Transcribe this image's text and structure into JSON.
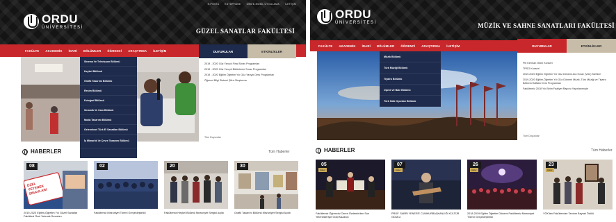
{
  "panel1": {
    "top_links": [
      "E-POSTA",
      "KÜTÜPHANE",
      "OBS/E-MOBİL UYGULAMA",
      "İLETİŞİM"
    ],
    "logo": {
      "name": "ORDU",
      "sub": "ÜNİVERSİTESİ"
    },
    "faculty": "GÜZEL SANATLAR FAKÜLTESİ",
    "nav": [
      "FAKÜLTE",
      "AKADEMİK",
      "İDARİ",
      "BÖLÜMLER",
      "ÖĞRENCİ",
      "ARAŞTIRMA",
      "İLETİŞİM"
    ],
    "tabs": {
      "announcements": "DUYURULAR",
      "events": "ETKİNLİKLER"
    },
    "dropdown": [
      "Sinema Ve Televizyon Bölümü",
      "Heykel Bölümü",
      "Grafik Tasarımı Bölümü",
      "Resim Bölümü",
      "Fotoğraf Bölümü",
      "Seramik Ve Cam Bölümü",
      "Moda Tasarımı Bölümü",
      "Geleneksel Türk El Sanatları Bölümü",
      "İç Mimarlık Ve Çevre Tasarımı Bölümü"
    ],
    "announcements": [
      "2019 - 2020 Güz Yarıyılı Final Sınav Programları",
      "2019 - 2020 Güz Yarıyılı Bütünleme Sınav Programları",
      "2019 - 2020 Eğitim Öğretim Yılı Güz Yarıyılı Ders Programları",
      "Öğrenci Bilgi Sistemi Şifre Oluşturma"
    ],
    "all_announcements": "Tüm Duyurular",
    "news_title": "HABERLER",
    "all_news": "Tüm Haberler",
    "news": [
      {
        "date": "08",
        "caption": "2019-2020 Eğitim-Öğretim Yılı Güzel Sanatlar Fakültesi Özel Yetenek Sınavları"
      },
      {
        "date": "02",
        "caption": "Fakültemiz Mezuniyet Töreni Gerçekleştirildi"
      },
      {
        "date": "20",
        "caption": "Fakültemiz Heykel Bölümü Mezuniyet Sergisi Açıldı"
      },
      {
        "date": "30",
        "caption": "Grafik Tasarımı Bölümü Mezuniyet Sergisi Açıldı"
      }
    ],
    "poster_text": [
      "ÖZEL",
      "YETENEK",
      "SINAVLARI"
    ]
  },
  "panel2": {
    "logo": {
      "name": "ORDU",
      "sub": "ÜNİVERSİTESİ"
    },
    "faculty": "MÜZİK VE SAHNE SANATLARI FAKÜLTESİ",
    "nav": [
      "FAKÜLTE",
      "AKADEMİK",
      "İDARİ",
      "BÖLÜMLER",
      "ÖĞRENCİ",
      "ARAŞTIRMA",
      "İLETİŞİM"
    ],
    "tabs": {
      "announcements": "DUYURULAR",
      "events": "ETKİNLİKLER"
    },
    "dropdown": [
      "Müzik Bölümü",
      "Türk Müziği Bölümü",
      "Tiyatro Bölümü",
      "Opera Ve Bale Bölümü",
      "Türk Halk Oyunları Bölümü"
    ],
    "announcements": [
      "Piri Kerman Ölüm Konseri",
      "TRSO Konseri",
      "2019-2020 Eğitim Öğretim Yılı Güz Dönemi Ara Sınav (Vize) Tarihleri",
      "2019-2020 Eğitim-Öğretim Yılı Güz Dönemi Müzik, Türk Müziği ve Tiyatro Bölümü Haftalık Ders Programları",
      "Fakültemiz 2018 Yılı Birim Faaliyet Raporu Yayınlanmıştır"
    ],
    "all_announcements": "Tüm Duyurular",
    "news_title": "HABERLER",
    "all_news": "Tüm Haberler",
    "news": [
      {
        "date": "05",
        "tag": "Haber",
        "caption": "Fakültemiz Öğrencisi Ceren Özdemir'den Sun Yetenekleriyle Ödül Kazandı"
      },
      {
        "date": "07",
        "tag": "Haber",
        "caption": "PROF. SABRİ YENER'E CUMHURBAŞKANLIĞI KÜLTÜR ÖDÜLÜ"
      },
      {
        "date": "26",
        "tag": "Haber",
        "caption": "2018-2019 Eğitim Öğretim Dönemi Fakültemiz Mezuniyet Töreni Gerçekleştirildi"
      },
      {
        "date": "23",
        "tag": "Haber",
        "caption": "YÖK'ten Fakültemize Tanıtım Bayrak Ödülü"
      }
    ]
  },
  "colors": {
    "nav_red": "#c8282c",
    "navy": "#1e2b4d",
    "beige": "#c7bca8",
    "header_dark": "#141414"
  }
}
